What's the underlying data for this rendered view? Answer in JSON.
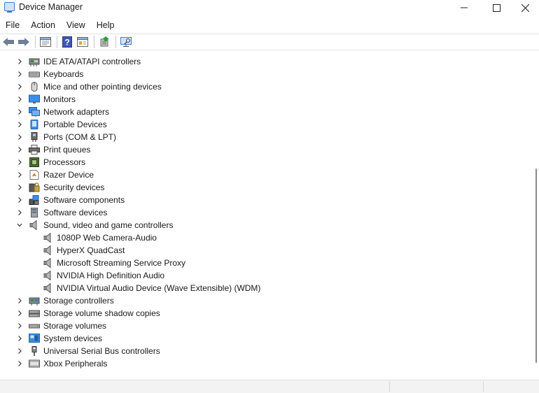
{
  "window": {
    "title": "Device Manager"
  },
  "menu": [
    "File",
    "Action",
    "View",
    "Help"
  ],
  "toolbar": [
    "back-icon",
    "forward-icon",
    "sep",
    "properties-icon",
    "sep",
    "help-icon",
    "view-icon",
    "sep",
    "update-driver-icon",
    "sep",
    "scan-hardware-icon"
  ],
  "tree": [
    {
      "label": "IDE ATA/ATAPI controllers",
      "icon": "ide-controller-icon",
      "level": 0,
      "expander": "collapsed"
    },
    {
      "label": "Keyboards",
      "icon": "keyboard-icon",
      "level": 0,
      "expander": "collapsed"
    },
    {
      "label": "Mice and other pointing devices",
      "icon": "mouse-icon",
      "level": 0,
      "expander": "collapsed"
    },
    {
      "label": "Monitors",
      "icon": "monitor-icon",
      "level": 0,
      "expander": "collapsed"
    },
    {
      "label": "Network adapters",
      "icon": "network-adapter-icon",
      "level": 0,
      "expander": "collapsed"
    },
    {
      "label": "Portable Devices",
      "icon": "portable-device-icon",
      "level": 0,
      "expander": "collapsed"
    },
    {
      "label": "Ports (COM & LPT)",
      "icon": "port-icon",
      "level": 0,
      "expander": "collapsed"
    },
    {
      "label": "Print queues",
      "icon": "printer-icon",
      "level": 0,
      "expander": "collapsed"
    },
    {
      "label": "Processors",
      "icon": "processor-icon",
      "level": 0,
      "expander": "collapsed"
    },
    {
      "label": "Razer Device",
      "icon": "razer-device-icon",
      "level": 0,
      "expander": "collapsed"
    },
    {
      "label": "Security devices",
      "icon": "security-device-icon",
      "level": 0,
      "expander": "collapsed"
    },
    {
      "label": "Software components",
      "icon": "software-component-icon",
      "level": 0,
      "expander": "collapsed"
    },
    {
      "label": "Software devices",
      "icon": "software-device-icon",
      "level": 0,
      "expander": "collapsed"
    },
    {
      "label": "Sound, video and game controllers",
      "icon": "speaker-icon",
      "level": 0,
      "expander": "expanded"
    },
    {
      "label": "1080P Web Camera-Audio",
      "icon": "speaker-icon",
      "level": 1,
      "expander": "none"
    },
    {
      "label": "HyperX QuadCast",
      "icon": "speaker-icon",
      "level": 1,
      "expander": "none"
    },
    {
      "label": "Microsoft Streaming Service Proxy",
      "icon": "speaker-icon",
      "level": 1,
      "expander": "none"
    },
    {
      "label": "NVIDIA High Definition Audio",
      "icon": "speaker-icon",
      "level": 1,
      "expander": "none"
    },
    {
      "label": "NVIDIA Virtual Audio Device (Wave Extensible) (WDM)",
      "icon": "speaker-icon",
      "level": 1,
      "expander": "none"
    },
    {
      "label": "Storage controllers",
      "icon": "storage-controller-icon",
      "level": 0,
      "expander": "collapsed"
    },
    {
      "label": "Storage volume shadow copies",
      "icon": "shadow-copy-icon",
      "level": 0,
      "expander": "collapsed"
    },
    {
      "label": "Storage volumes",
      "icon": "storage-volume-icon",
      "level": 0,
      "expander": "collapsed"
    },
    {
      "label": "System devices",
      "icon": "system-device-icon",
      "level": 0,
      "expander": "collapsed"
    },
    {
      "label": "Universal Serial Bus controllers",
      "icon": "usb-icon",
      "level": 0,
      "expander": "collapsed"
    },
    {
      "label": "Xbox Peripherals",
      "icon": "xbox-peripheral-icon",
      "level": 0,
      "expander": "collapsed"
    }
  ]
}
